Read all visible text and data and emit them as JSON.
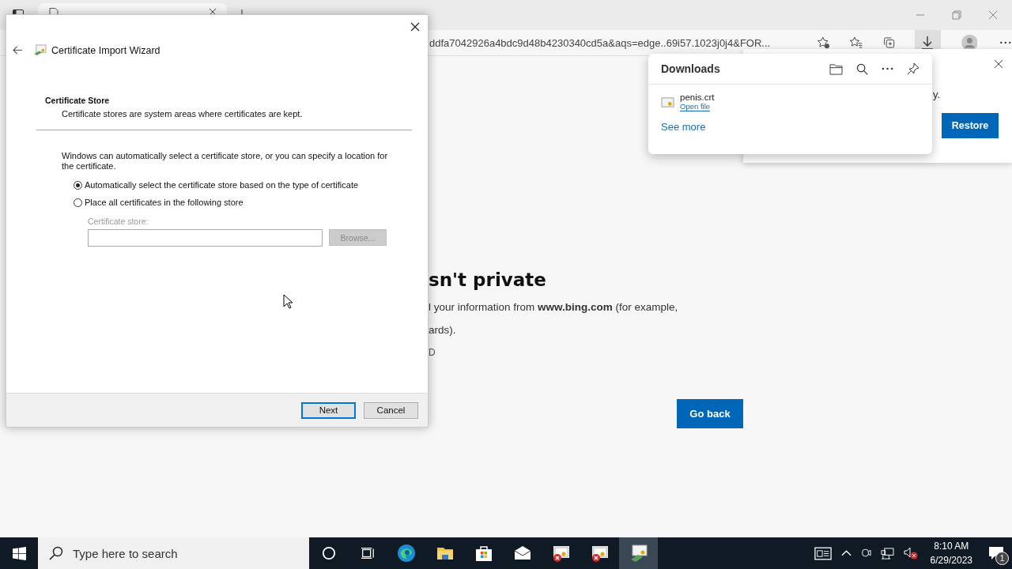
{
  "browser": {
    "address": "ddfa7042926a4bdc9d48b4230340cd5a&aqs=edge..69i57.1023j0j4&FOR...",
    "downloads_open": true
  },
  "page": {
    "heading": "sn't private",
    "lines": [
      "l your information from **www.bing.com** (for example,",
      "ards)."
    ],
    "code": "D",
    "button": "Go back"
  },
  "notification": {
    "text": "y.",
    "button": "Restore"
  },
  "downloads": {
    "title": "Downloads",
    "items": [
      {
        "name": "penis.crt",
        "action": "Open file"
      }
    ],
    "see_more": "See more"
  },
  "dialog": {
    "title": "Certificate Import Wizard",
    "section_title": "Certificate Store",
    "section_desc": "Certificate stores are system areas where certificates are kept.",
    "intro": "Windows can automatically select a certificate store, or you can specify a location for the certificate.",
    "options": [
      {
        "label": "Automatically select the certificate store based on the type of certificate",
        "selected": true
      },
      {
        "label": "Place all certificates in the following store",
        "selected": false
      }
    ],
    "store_label": "Certificate store:",
    "browse": {
      "label": "Browse...",
      "disabled": true
    },
    "buttons": [
      {
        "label": "Next",
        "default": true
      },
      {
        "label": "Cancel",
        "default": false
      }
    ]
  },
  "taskbar": {
    "search_placeholder": "Type here to search",
    "apps": [
      {
        "kind": "cortana",
        "active": false
      },
      {
        "kind": "taskview",
        "active": false
      },
      {
        "kind": "edge",
        "active": false
      },
      {
        "kind": "explorer",
        "active": false
      },
      {
        "kind": "store",
        "active": false
      },
      {
        "kind": "mail",
        "active": false
      },
      {
        "kind": "cert-error",
        "active": false
      },
      {
        "kind": "cert-error",
        "active": false
      },
      {
        "kind": "cert",
        "active": true
      }
    ],
    "time": "8:10 AM",
    "date": "6/29/2023",
    "notifications": "1"
  }
}
